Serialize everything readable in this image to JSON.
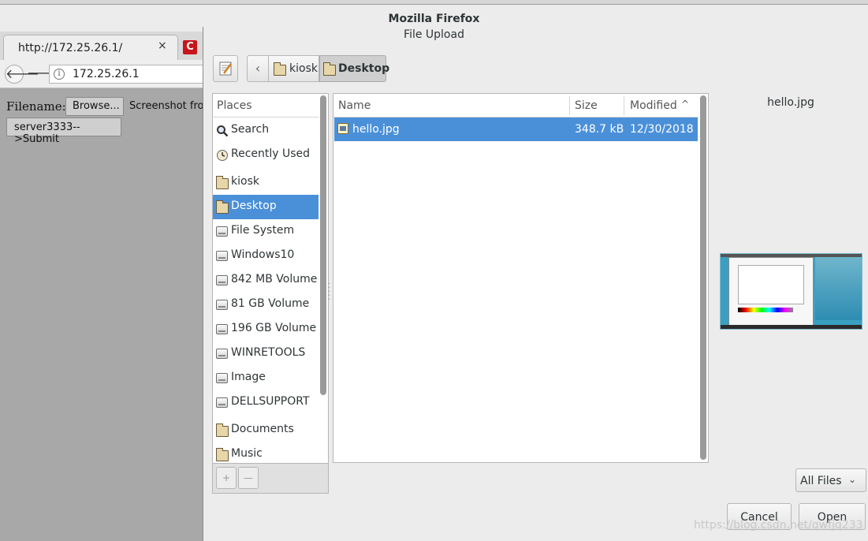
{
  "window": {
    "app_title": "Mozilla Firefox",
    "dialog_title": "File Upload"
  },
  "browser": {
    "tab_title": "http://172.25.26.1/",
    "tab_close": "×",
    "extension_label": "C",
    "url": "172.25.26.1",
    "back_glyph": "🡐",
    "forward_glyph": "🡒",
    "info_glyph": "i"
  },
  "webpage": {
    "filename_label": "Filename:",
    "browse_label": "Browse...",
    "screenshot_text": "Screenshot from",
    "submit_label": "server3333-->Submit"
  },
  "toolbar": {
    "back_glyph": "‹",
    "breadcrumbs": [
      "kiosk",
      "Desktop"
    ]
  },
  "places": {
    "header": "Places",
    "items": [
      {
        "label": "Search",
        "icon": "search-icon"
      },
      {
        "label": "Recently Used",
        "icon": "recent-icon"
      },
      {
        "label": "kiosk",
        "icon": "home-folder-icon"
      },
      {
        "label": "Desktop",
        "icon": "desktop-folder-icon",
        "selected": true
      },
      {
        "label": "File System",
        "icon": "drive-icon"
      },
      {
        "label": "Windows10",
        "icon": "drive-icon"
      },
      {
        "label": "842 MB Volume",
        "icon": "drive-icon"
      },
      {
        "label": "81 GB Volume",
        "icon": "drive-icon"
      },
      {
        "label": "196 GB Volume",
        "icon": "drive-icon"
      },
      {
        "label": "WINRETOOLS",
        "icon": "drive-icon"
      },
      {
        "label": "Image",
        "icon": "drive-icon"
      },
      {
        "label": "DELLSUPPORT",
        "icon": "drive-icon"
      },
      {
        "label": "Documents",
        "icon": "documents-folder-icon"
      },
      {
        "label": "Music",
        "icon": "music-folder-icon"
      }
    ],
    "add_glyph": "+",
    "remove_glyph": "—"
  },
  "files": {
    "columns": {
      "name": "Name",
      "size": "Size",
      "modified": "Modified"
    },
    "sort_glyph": "^",
    "rows": [
      {
        "name": "hello.jpg",
        "size": "348.7 kB",
        "modified": "12/30/2018",
        "selected": true
      }
    ]
  },
  "preview": {
    "filename": "hello.jpg"
  },
  "footer": {
    "filter": "All Files",
    "filter_arrow": "⌄",
    "cancel": "Cancel",
    "open": "Open",
    "watermark": "https://blog.csdn.net/qwfjq233"
  },
  "colors": {
    "selection": "#4a90d9",
    "dialog_bg": "#ececec",
    "page_bg": "#a8a8a8"
  }
}
